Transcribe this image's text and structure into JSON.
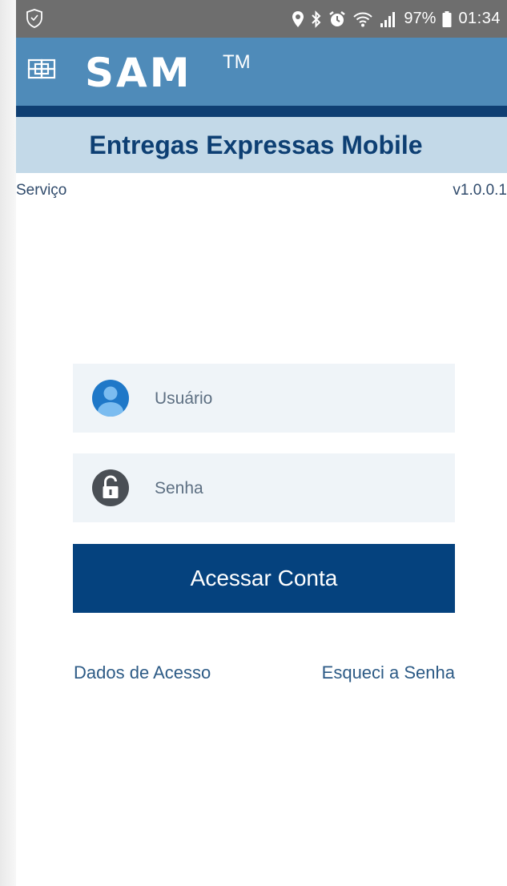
{
  "status_bar": {
    "battery": "97%",
    "time": "01:34",
    "icons": [
      "shield-icon",
      "location-icon",
      "bluetooth-icon",
      "alarm-icon",
      "wifi-icon",
      "signal-icon",
      "battery-icon"
    ]
  },
  "header": {
    "logo_text": "SAM",
    "trademark": "TM",
    "logo_icon": "grid-logo-icon",
    "brand_color": "#4f8bb9",
    "stripe_color": "#0f3f73"
  },
  "title_band": {
    "title": "Entregas Expressas Mobile",
    "background": "#c3d9e8"
  },
  "info_row": {
    "service": "Serviço",
    "version": "v1.0.0.1"
  },
  "login": {
    "username": {
      "placeholder": "Usuário",
      "value": "",
      "icon": "user-icon"
    },
    "password": {
      "placeholder": "Senha",
      "value": "",
      "icon": "lock-icon"
    },
    "submit_label": "Acessar Conta",
    "submit_color": "#05427e"
  },
  "links": {
    "access_data": "Dados de Acesso",
    "forgot_password": "Esqueci a Senha"
  }
}
